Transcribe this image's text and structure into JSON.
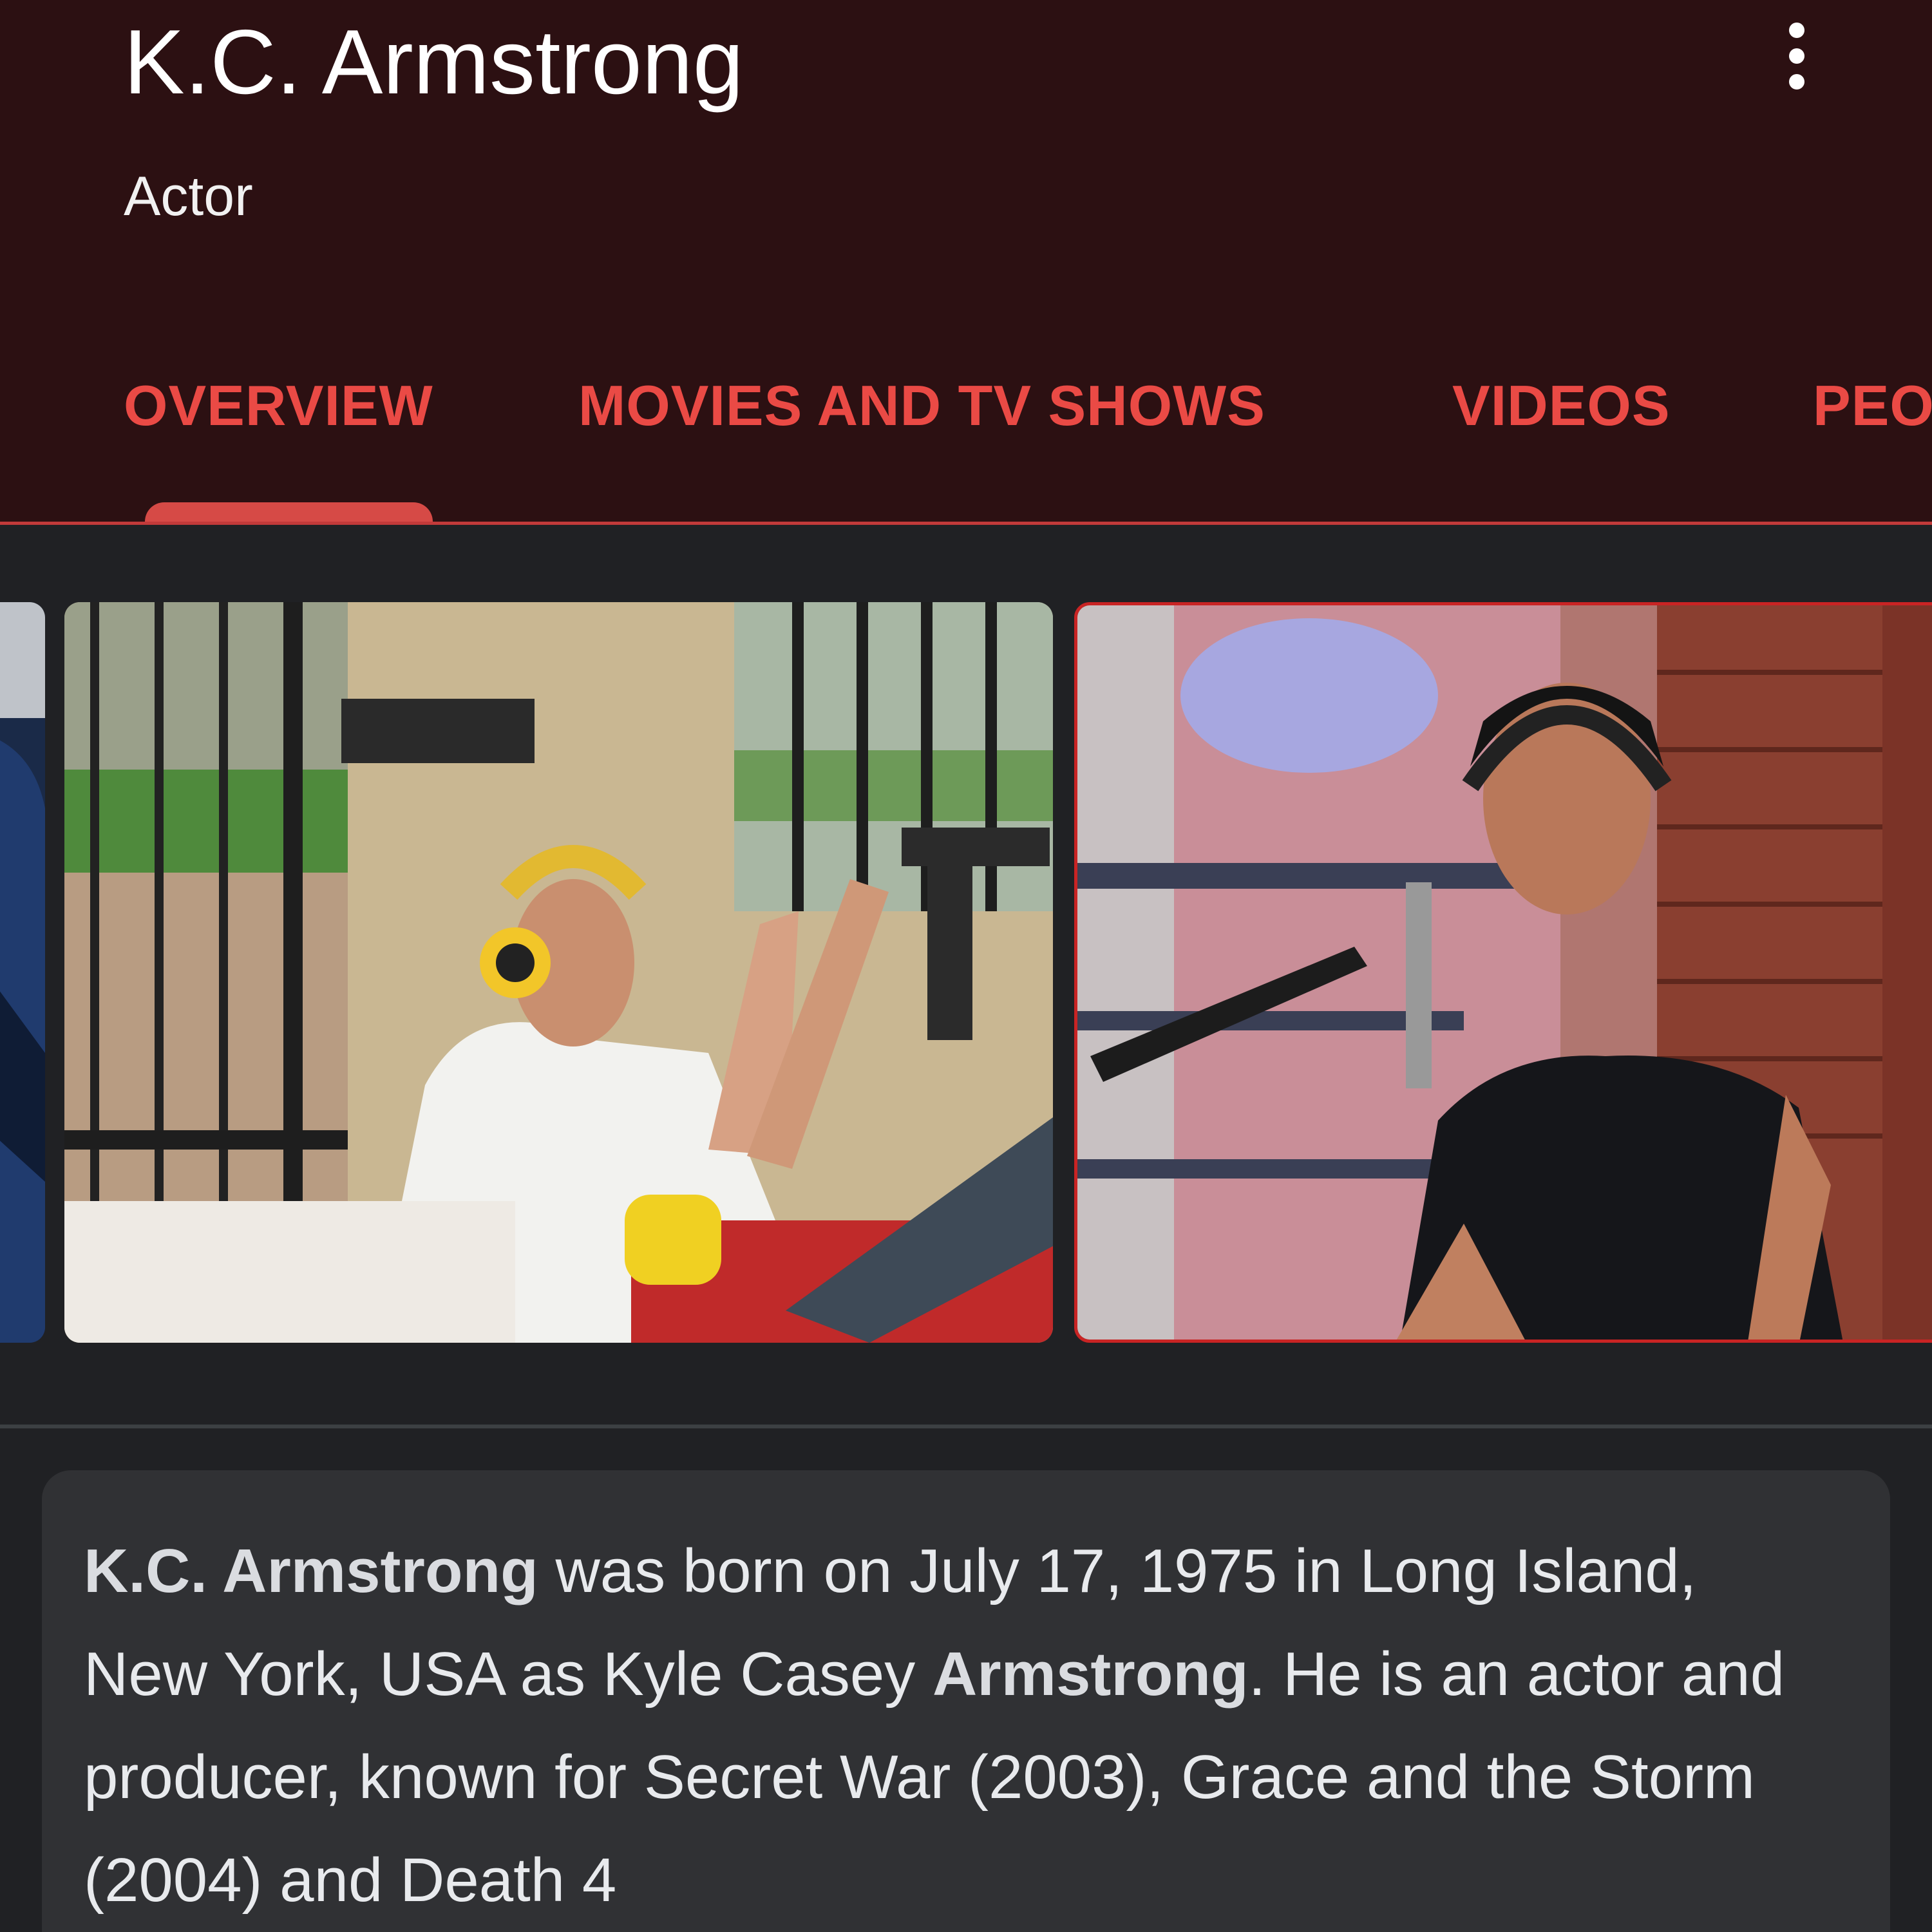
{
  "entity": {
    "name": "K.C. Armstrong",
    "subtitle": "Actor"
  },
  "header": {
    "more_icon": "more-vert-icon"
  },
  "tabs": [
    {
      "label": "OVERVIEW",
      "selected": true
    },
    {
      "label": "MOVIES AND TV SHOWS",
      "selected": false
    },
    {
      "label": "VIDEOS",
      "selected": false
    },
    {
      "label": "PEO",
      "selected": false
    }
  ],
  "colors": {
    "header_bg": "#2c1012",
    "accent": "#ea4a45",
    "page_bg": "#202124",
    "card_bg": "#303134"
  },
  "description": {
    "seg1_bold": "K.C. Armstrong",
    "seg2": " was born on July 17, 1975 in Long Island, New York, USA as Kyle Casey ",
    "seg3_bold": "Armstrong",
    "seg4": ". He is an actor and producer, known for Secret War (2003), Grace and the Storm (2004) and Death 4"
  }
}
